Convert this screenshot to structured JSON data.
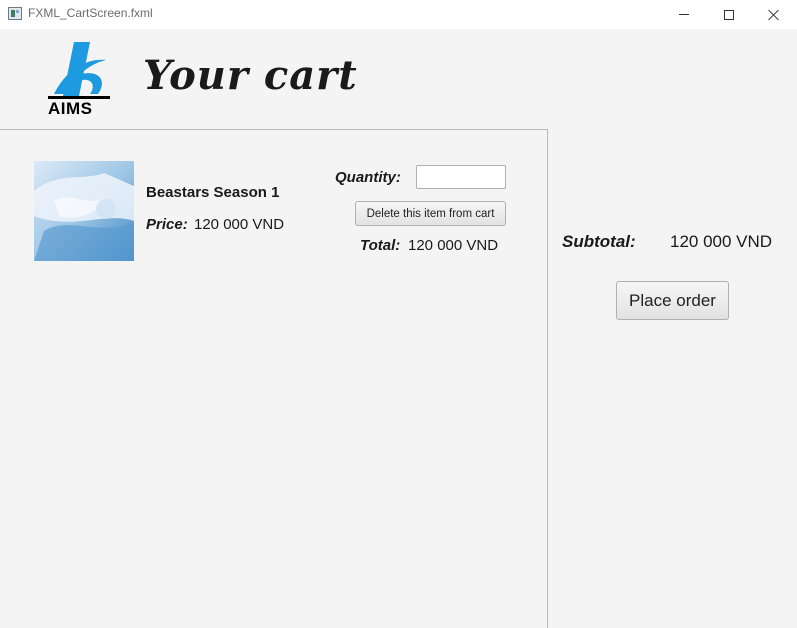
{
  "window": {
    "title": "FXML_CartScreen.fxml"
  },
  "header": {
    "logo_text": "AIMS",
    "title": "Your cart"
  },
  "cart": {
    "items": [
      {
        "title": "Beastars Season 1",
        "price_label": "Price:",
        "price": "120 000 VND",
        "quantity_label": "Quantity:",
        "quantity_value": "",
        "delete_label": "Delete this item from cart",
        "total_label": "Total:",
        "total": "120 000 VND"
      }
    ]
  },
  "summary": {
    "subtotal_label": "Subtotal:",
    "subtotal": "120 000 VND",
    "place_order_label": "Place order"
  },
  "colors": {
    "background": "#f4f4f4",
    "logo_blue": "#1e9be0",
    "divider": "#b8b8b8"
  },
  "icons": {
    "app": "app-window-icon",
    "minimize": "minimize-icon",
    "maximize": "maximize-icon",
    "close": "close-icon"
  }
}
